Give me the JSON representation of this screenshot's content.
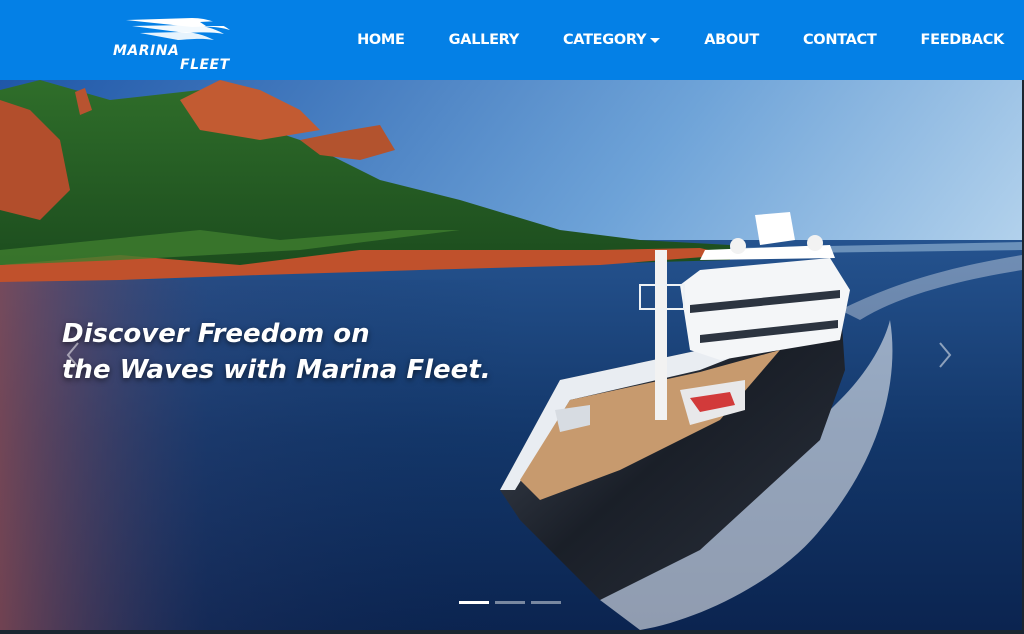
{
  "brand": {
    "line1": "MARINA",
    "line2": "FLEET"
  },
  "nav": {
    "items": [
      {
        "label": "HOME"
      },
      {
        "label": "GALLERY"
      },
      {
        "label": "CATEGORY"
      },
      {
        "label": "ABOUT"
      },
      {
        "label": "CONTACT"
      },
      {
        "label": "FEEDBACK"
      }
    ]
  },
  "hero": {
    "title_line1": "Discover Freedom on",
    "title_line2": "the Waves with Marina Fleet.",
    "active_slide": 1,
    "slide_count": 3
  },
  "icons": {
    "brand": "boat-wave-logo-icon",
    "dropdown": "caret-down-icon",
    "prev": "chevron-left-icon",
    "next": "chevron-right-icon"
  },
  "colors": {
    "navbar": "#0480e6",
    "text": "#ffffff"
  }
}
